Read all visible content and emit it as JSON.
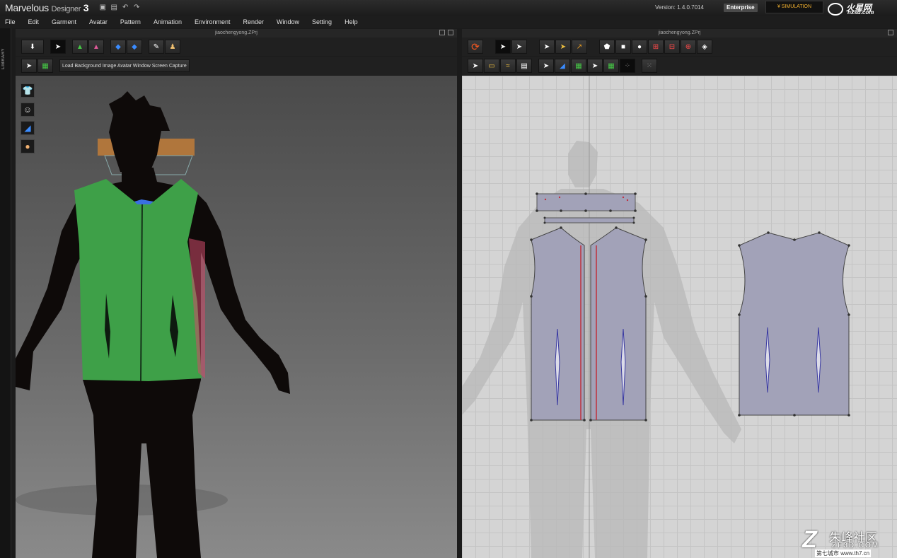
{
  "app": {
    "name": "Marvelous",
    "name_suffix": "Designer",
    "version_number": "3",
    "version_label": "Version:",
    "version_value": "1.4.0.7014",
    "edition": "Enterprise",
    "mode": "SIMULATION"
  },
  "logo": {
    "text": "火星网",
    "sub": "hxsd.com"
  },
  "menu": [
    "File",
    "Edit",
    "Garment",
    "Avatar",
    "Pattern",
    "Animation",
    "Environment",
    "Render",
    "Window",
    "Setting",
    "Help"
  ],
  "library_label": "LIBRARY",
  "left_panel": {
    "title": "jiaochengyong.ZPrj",
    "load_button": "Load Background Image Avatar Window Screen Capture"
  },
  "right_panel": {
    "title": "jiaochengyong.ZPrj"
  },
  "side_icons": [
    "shirt-icon",
    "avatar-icon",
    "measure-icon",
    "head-icon"
  ],
  "watermark": {
    "letter": "Z",
    "text": "朱峰社区",
    "site": "ZF3D.COM",
    "bottom": "第七城市 www.th7.cn"
  }
}
